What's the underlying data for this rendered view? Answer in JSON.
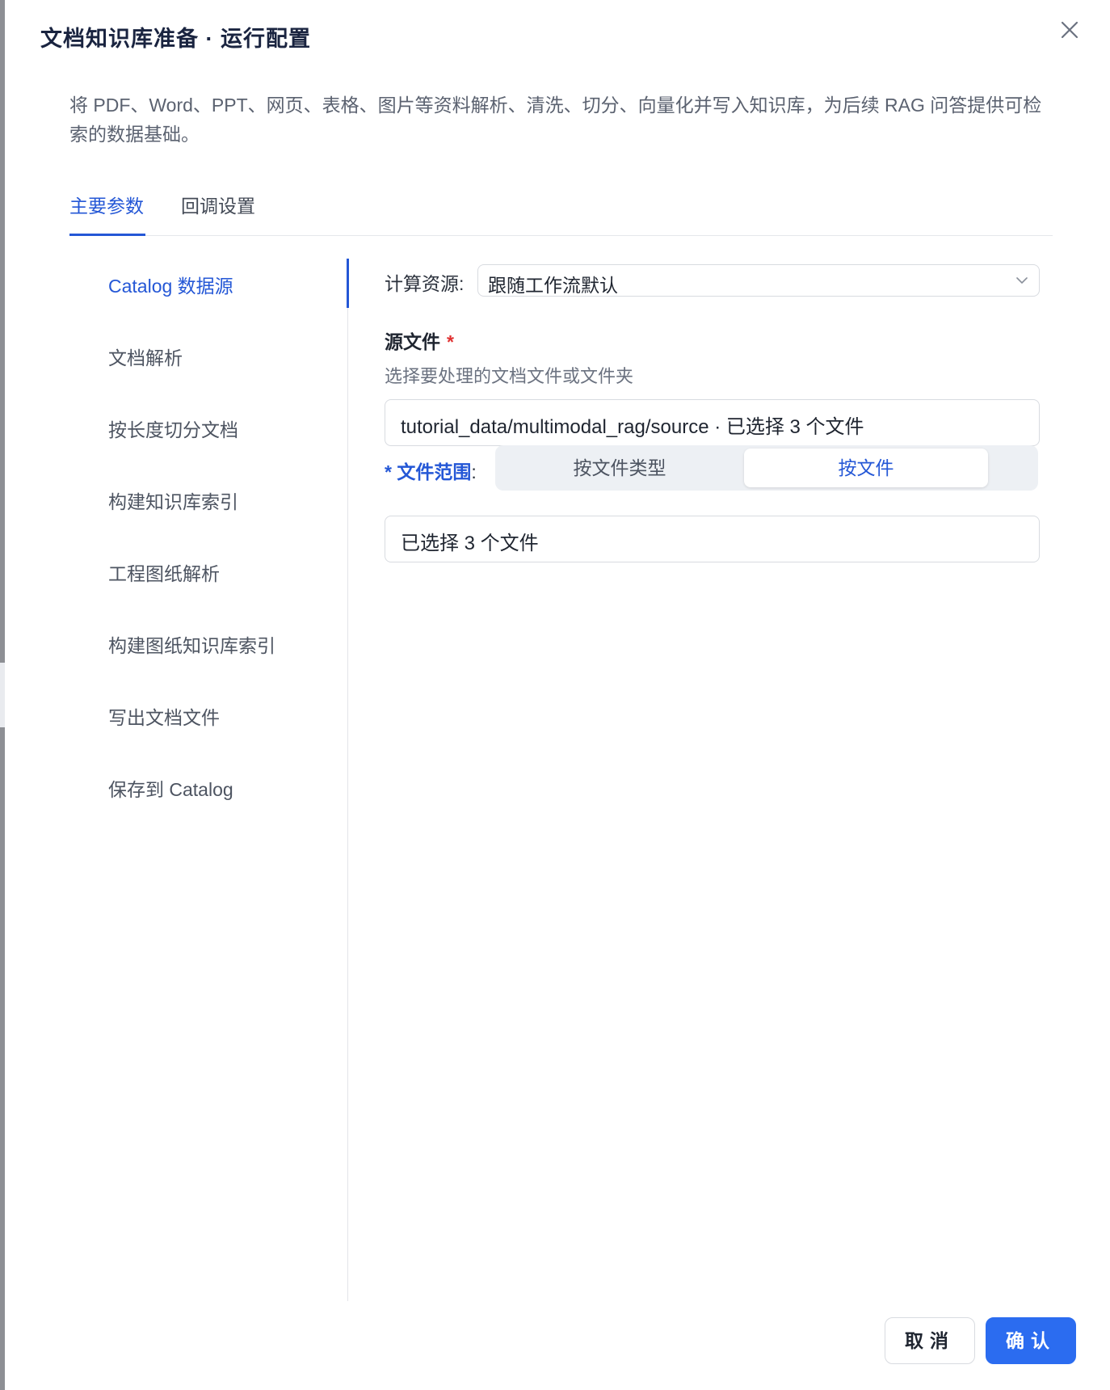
{
  "dialog": {
    "title": "文档知识库准备 · 运行配置",
    "description": "将 PDF、Word、PPT、网页、表格、图片等资料解析、清洗、切分、向量化并写入知识库，为后续 RAG 问答提供可检索的数据基础。"
  },
  "tabs": [
    {
      "label": "主要参数",
      "active": true
    },
    {
      "label": "回调设置",
      "active": false
    }
  ],
  "sidebar": {
    "items": [
      {
        "label": "Catalog 数据源",
        "active": true
      },
      {
        "label": "文档解析"
      },
      {
        "label": "按长度切分文档"
      },
      {
        "label": "构建知识库索引"
      },
      {
        "label": "工程图纸解析"
      },
      {
        "label": "构建图纸知识库索引"
      },
      {
        "label": "写出文档文件"
      },
      {
        "label": "保存到 Catalog"
      }
    ]
  },
  "form": {
    "compute_label": "计算资源:",
    "compute_value": "跟随工作流默认",
    "source_title": "源文件",
    "required_mark": "*",
    "source_hint": "选择要处理的文档文件或文件夹",
    "source_value": "tutorial_data/multimodal_rag/source · 已选择 3 个文件",
    "scope_required": "*",
    "scope_label": "文件范围",
    "scope_colon": ":",
    "scope_options": [
      {
        "label": "按文件类型",
        "active": false
      },
      {
        "label": "按文件",
        "active": true
      }
    ],
    "files_value": "已选择 3 个文件"
  },
  "footer": {
    "cancel_label": "取消",
    "confirm_label": "确认"
  },
  "colors": {
    "accent": "#2457d6",
    "primary_button": "#2b6cf0"
  },
  "icons": {
    "close": "close-icon",
    "dropdown": "chevron-down-icon"
  }
}
